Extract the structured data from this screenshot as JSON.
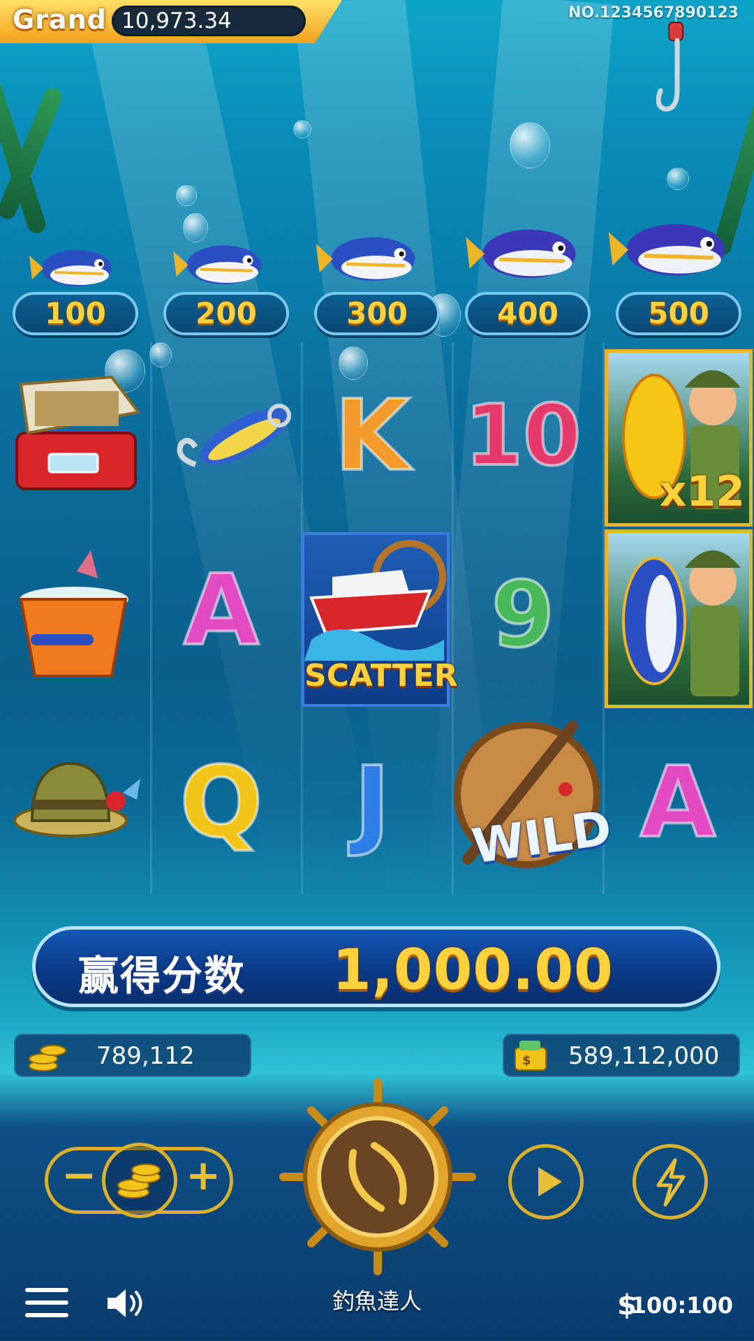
{
  "header": {
    "jackpot_label": "Grand",
    "jackpot_value": "10,973.34",
    "serial": "NO.1234567890123"
  },
  "paytable": [
    {
      "value": "100"
    },
    {
      "value": "200"
    },
    {
      "value": "300"
    },
    {
      "value": "400"
    },
    {
      "value": "500"
    }
  ],
  "reels": {
    "row1": [
      "tackle-box",
      "fishing-lure",
      "K",
      "10",
      "fisherman-golden-fish"
    ],
    "row2": [
      "ice-bucket-fish",
      "A",
      "SCATTER",
      "9",
      "fisherman-tuna"
    ],
    "row3": [
      "fishing-hat",
      "Q",
      "J",
      "WILD",
      "A"
    ],
    "letters": {
      "K": "K",
      "ten": "10",
      "A": "A",
      "nine": "9",
      "Q": "Q",
      "J": "J"
    },
    "scatter_label": "SCATTER",
    "wild_label": "WILD",
    "multiplier": "x12"
  },
  "win": {
    "label": "赢得分数",
    "value": "1,000.00"
  },
  "stats": {
    "bet": "789,112",
    "balance": "589,112,000"
  },
  "controls": {
    "minus": "−",
    "plus": "+"
  },
  "footer": {
    "game_title": "釣魚達人",
    "currency_symbol": "$",
    "ratio": "100:100"
  },
  "colors": {
    "gold": "#ffd23c",
    "ring": "#d9b12a",
    "pill_bg": "#0d5f93",
    "win_bar_bg": "#1358b8"
  }
}
